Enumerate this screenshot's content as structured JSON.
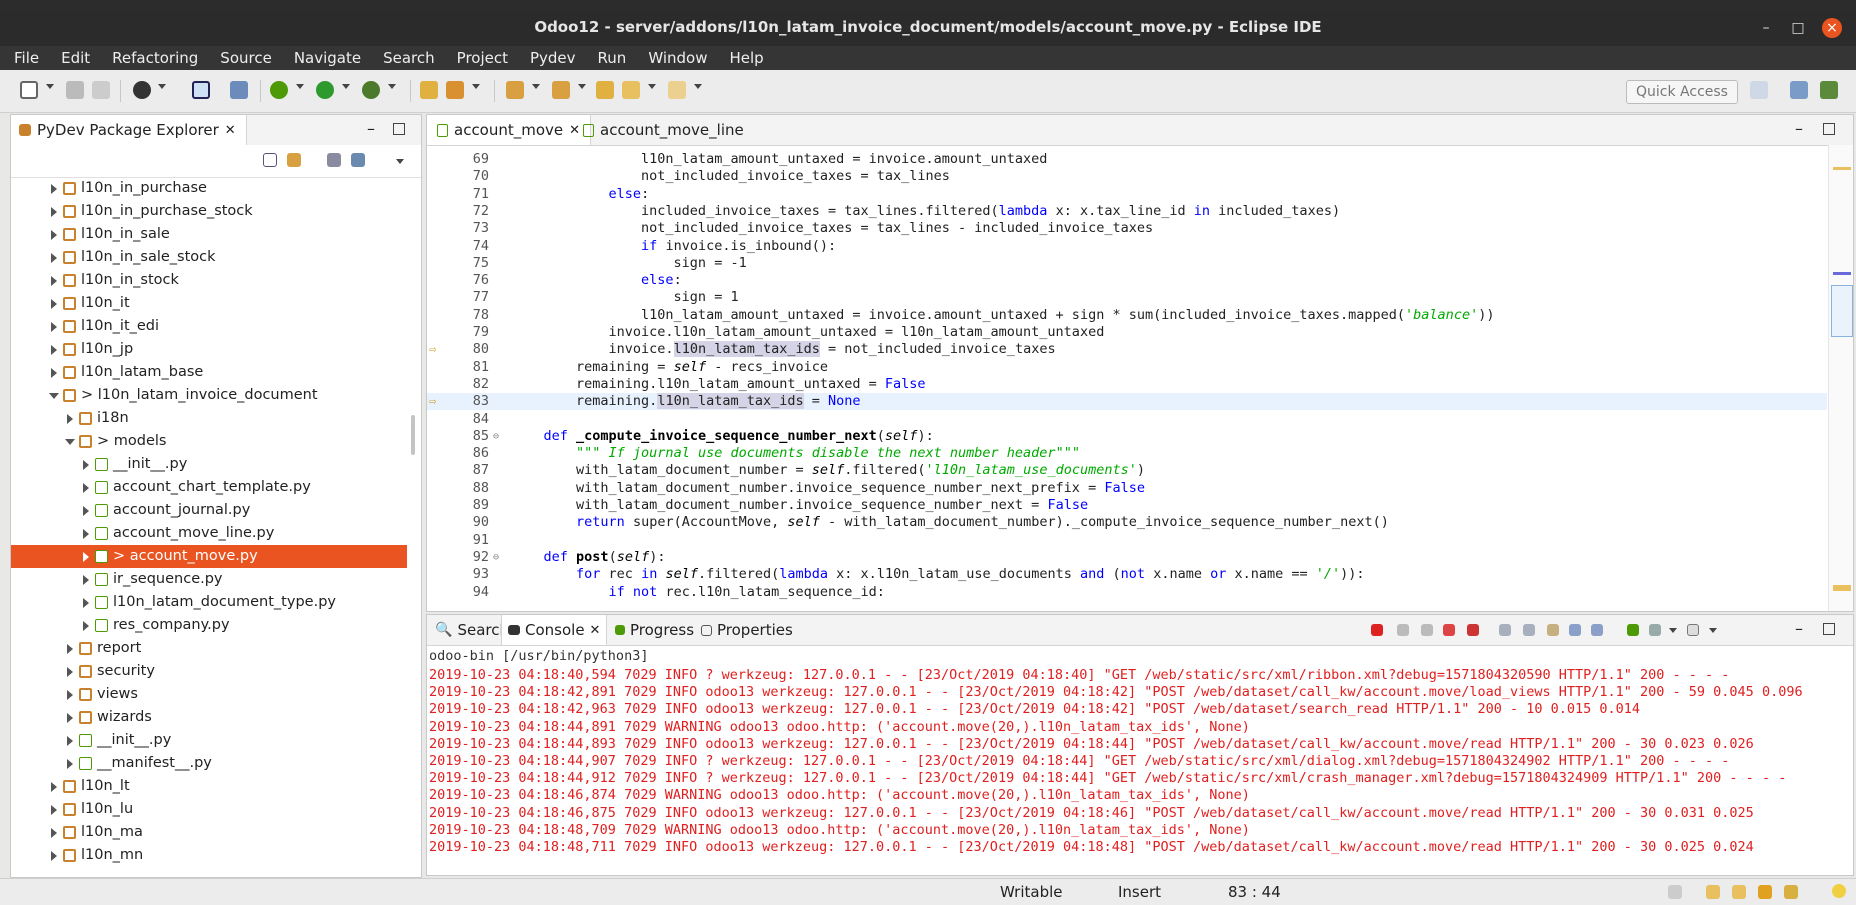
{
  "window": {
    "title": "Odoo12 - server/addons/l10n_latam_invoice_document/models/account_move.py - Eclipse IDE"
  },
  "menu": [
    "File",
    "Edit",
    "Refactoring",
    "Source",
    "Navigate",
    "Search",
    "Project",
    "Pydev",
    "Run",
    "Window",
    "Help"
  ],
  "toolbar": {
    "quick_access": "Quick Access"
  },
  "explorer": {
    "tab": "PyDev Package Explorer",
    "rows": [
      {
        "label": "l10n_in_purchase",
        "level": 0,
        "type": "pkg",
        "open": false
      },
      {
        "label": "l10n_in_purchase_stock",
        "level": 0,
        "type": "pkg",
        "open": false
      },
      {
        "label": "l10n_in_sale",
        "level": 0,
        "type": "pkg",
        "open": false
      },
      {
        "label": "l10n_in_sale_stock",
        "level": 0,
        "type": "pkg",
        "open": false
      },
      {
        "label": "l10n_in_stock",
        "level": 0,
        "type": "pkg",
        "open": false
      },
      {
        "label": "l10n_it",
        "level": 0,
        "type": "pkg",
        "open": false
      },
      {
        "label": "l10n_it_edi",
        "level": 0,
        "type": "pkg",
        "open": false
      },
      {
        "label": "l10n_jp",
        "level": 0,
        "type": "pkg",
        "open": false
      },
      {
        "label": "l10n_latam_base",
        "level": 0,
        "type": "pkg",
        "open": false
      },
      {
        "label": "> l10n_latam_invoice_document",
        "level": 0,
        "type": "pkg",
        "open": true
      },
      {
        "label": "i18n",
        "level": 1,
        "type": "pkg",
        "open": false
      },
      {
        "label": "> models",
        "level": 1,
        "type": "pkg",
        "open": true
      },
      {
        "label": "__init__.py",
        "level": 2,
        "type": "py",
        "open": false
      },
      {
        "label": "account_chart_template.py",
        "level": 2,
        "type": "py",
        "open": false
      },
      {
        "label": "account_journal.py",
        "level": 2,
        "type": "py",
        "open": false
      },
      {
        "label": "account_move_line.py",
        "level": 2,
        "type": "py",
        "open": false
      },
      {
        "label": "> account_move.py",
        "level": 2,
        "type": "py",
        "open": false,
        "selected": true
      },
      {
        "label": "ir_sequence.py",
        "level": 2,
        "type": "py",
        "open": false
      },
      {
        "label": "l10n_latam_document_type.py",
        "level": 2,
        "type": "py",
        "open": false
      },
      {
        "label": "res_company.py",
        "level": 2,
        "type": "py",
        "open": false
      },
      {
        "label": "report",
        "level": 1,
        "type": "pkg",
        "open": false
      },
      {
        "label": "security",
        "level": 1,
        "type": "pkg",
        "open": false
      },
      {
        "label": "views",
        "level": 1,
        "type": "pkg",
        "open": false
      },
      {
        "label": "wizards",
        "level": 1,
        "type": "pkg",
        "open": false
      },
      {
        "label": "__init__.py",
        "level": 1,
        "type": "py",
        "open": false
      },
      {
        "label": "__manifest__.py",
        "level": 1,
        "type": "py",
        "open": false
      },
      {
        "label": "l10n_lt",
        "level": 0,
        "type": "pkg",
        "open": false
      },
      {
        "label": "l10n_lu",
        "level": 0,
        "type": "pkg",
        "open": false
      },
      {
        "label": "l10n_ma",
        "level": 0,
        "type": "pkg",
        "open": false
      },
      {
        "label": "l10n_mn",
        "level": 0,
        "type": "pkg",
        "open": false
      }
    ]
  },
  "editor": {
    "tabs": [
      "account_move",
      "account_move_line"
    ],
    "lines": [
      {
        "n": "69",
        "code": "                l10n_latam_amount_untaxed = invoice.amount_untaxed"
      },
      {
        "n": "70",
        "code": "                not_included_invoice_taxes = tax_lines"
      },
      {
        "n": "71",
        "code": "            <span class=\"kw\">else</span>:"
      },
      {
        "n": "72",
        "code": "                included_invoice_taxes = tax_lines.filtered(<span class=\"kw\">lambda</span> x: x.tax_line_id <span class=\"kw\">in</span> included_taxes)"
      },
      {
        "n": "73",
        "code": "                not_included_invoice_taxes = tax_lines - included_invoice_taxes"
      },
      {
        "n": "74",
        "code": "                <span class=\"kw\">if</span> invoice.is_inbound():"
      },
      {
        "n": "75",
        "code": "                    sign = -1"
      },
      {
        "n": "76",
        "code": "                <span class=\"kw\">else</span>:"
      },
      {
        "n": "77",
        "code": "                    sign = 1"
      },
      {
        "n": "78",
        "code": "                l10n_latam_amount_untaxed = invoice.amount_untaxed + sign * sum(included_invoice_taxes.mapped(<span class=\"str\">'balance'</span>))"
      },
      {
        "n": "79",
        "code": "            invoice.l10n_latam_amount_untaxed = l10n_latam_amount_untaxed"
      },
      {
        "n": "80",
        "code": "            invoice.<span class=\"hl\">l10n_latam_tax_ids</span> = not_included_invoice_taxes",
        "mark": true
      },
      {
        "n": "81",
        "code": "        remaining = <span class=\"sf\">self</span> - recs_invoice"
      },
      {
        "n": "82",
        "code": "        remaining.l10n_latam_amount_untaxed = <span class=\"kw\">False</span>"
      },
      {
        "n": "83",
        "code": "        remaining.<span class=\"hl\">l10n_latam_tax_ids</span> = <span class=\"kw\">None</span>",
        "mark": true,
        "current": true
      },
      {
        "n": "84",
        "code": ""
      },
      {
        "n": "85",
        "code": "    <span class=\"kw\">def</span> <span class=\"fn\">_compute_invoice_sequence_number_next</span>(<span class=\"sf\">self</span>):",
        "fold": true
      },
      {
        "n": "86",
        "code": "        <span class=\"str\">\"\"\" If journal use documents disable the next number header\"\"\"</span>"
      },
      {
        "n": "87",
        "code": "        with_latam_document_number = <span class=\"sf\">self</span>.filtered(<span class=\"str\">'l10n_latam_use_documents'</span>)"
      },
      {
        "n": "88",
        "code": "        with_latam_document_number.invoice_sequence_number_next_prefix = <span class=\"kw\">False</span>"
      },
      {
        "n": "89",
        "code": "        with_latam_document_number.invoice_sequence_number_next = <span class=\"kw\">False</span>"
      },
      {
        "n": "90",
        "code": "        <span class=\"kw\">return</span> super(AccountMove, <span class=\"sf\">self</span> - with_latam_document_number)._compute_invoice_sequence_number_next()"
      },
      {
        "n": "91",
        "code": ""
      },
      {
        "n": "92",
        "code": "    <span class=\"kw\">def</span> <span class=\"fn\">post</span>(<span class=\"sf\">self</span>):",
        "fold": true
      },
      {
        "n": "93",
        "code": "        <span class=\"kw\">for</span> rec <span class=\"kw\">in</span> <span class=\"sf\">self</span>.filtered(<span class=\"kw\">lambda</span> x: x.l10n_latam_use_documents <span class=\"kw\">and</span> (<span class=\"kw\">not</span> x.name <span class=\"kw\">or</span> x.name == <span class=\"str\">'/'</span>)):"
      },
      {
        "n": "94",
        "code": "            <span class=\"kw\">if not</span> rec.l10n_latam_sequence_id:"
      }
    ]
  },
  "bottom": {
    "tabs": [
      "Search",
      "Console",
      "Progress",
      "Properties"
    ],
    "console_title": "odoo-bin [/usr/bin/python3]",
    "lines": [
      "2019-10-23 04:18:40,594 7029 INFO ? werkzeug: 127.0.0.1 - - [23/Oct/2019 04:18:40] \"GET /web/static/src/xml/ribbon.xml?debug=1571804320590 HTTP/1.1\" 200 - - - -",
      "2019-10-23 04:18:42,891 7029 INFO odoo13 werkzeug: 127.0.0.1 - - [23/Oct/2019 04:18:42] \"POST /web/dataset/call_kw/account.move/load_views HTTP/1.1\" 200 - 59 0.045 0.096",
      "2019-10-23 04:18:42,963 7029 INFO odoo13 werkzeug: 127.0.0.1 - - [23/Oct/2019 04:18:42] \"POST /web/dataset/search_read HTTP/1.1\" 200 - 10 0.015 0.014",
      "2019-10-23 04:18:44,891 7029 WARNING odoo13 odoo.http: ('account.move(20,).l10n_latam_tax_ids', None)",
      "2019-10-23 04:18:44,893 7029 INFO odoo13 werkzeug: 127.0.0.1 - - [23/Oct/2019 04:18:44] \"POST /web/dataset/call_kw/account.move/read HTTP/1.1\" 200 - 30 0.023 0.026",
      "2019-10-23 04:18:44,907 7029 INFO ? werkzeug: 127.0.0.1 - - [23/Oct/2019 04:18:44] \"GET /web/static/src/xml/dialog.xml?debug=1571804324902 HTTP/1.1\" 200 - - - -",
      "2019-10-23 04:18:44,912 7029 INFO ? werkzeug: 127.0.0.1 - - [23/Oct/2019 04:18:44] \"GET /web/static/src/xml/crash_manager.xml?debug=1571804324909 HTTP/1.1\" 200 - - - -",
      "2019-10-23 04:18:46,874 7029 WARNING odoo13 odoo.http: ('account.move(20,).l10n_latam_tax_ids', None)",
      "2019-10-23 04:18:46,875 7029 INFO odoo13 werkzeug: 127.0.0.1 - - [23/Oct/2019 04:18:46] \"POST /web/dataset/call_kw/account.move/read HTTP/1.1\" 200 - 30 0.031 0.025",
      "2019-10-23 04:18:48,709 7029 WARNING odoo13 odoo.http: ('account.move(20,).l10n_latam_tax_ids', None)",
      "2019-10-23 04:18:48,711 7029 INFO odoo13 werkzeug: 127.0.0.1 - - [23/Oct/2019 04:18:48] \"POST /web/dataset/call_kw/account.move/read HTTP/1.1\" 200 - 30 0.025 0.024"
    ]
  },
  "status": {
    "writable": "Writable",
    "insert": "Insert",
    "position": "83 : 44"
  },
  "colors": {
    "accent": "#e95420",
    "keyword": "#0000ff",
    "string": "#00aa00",
    "console_error": "#e02020"
  }
}
